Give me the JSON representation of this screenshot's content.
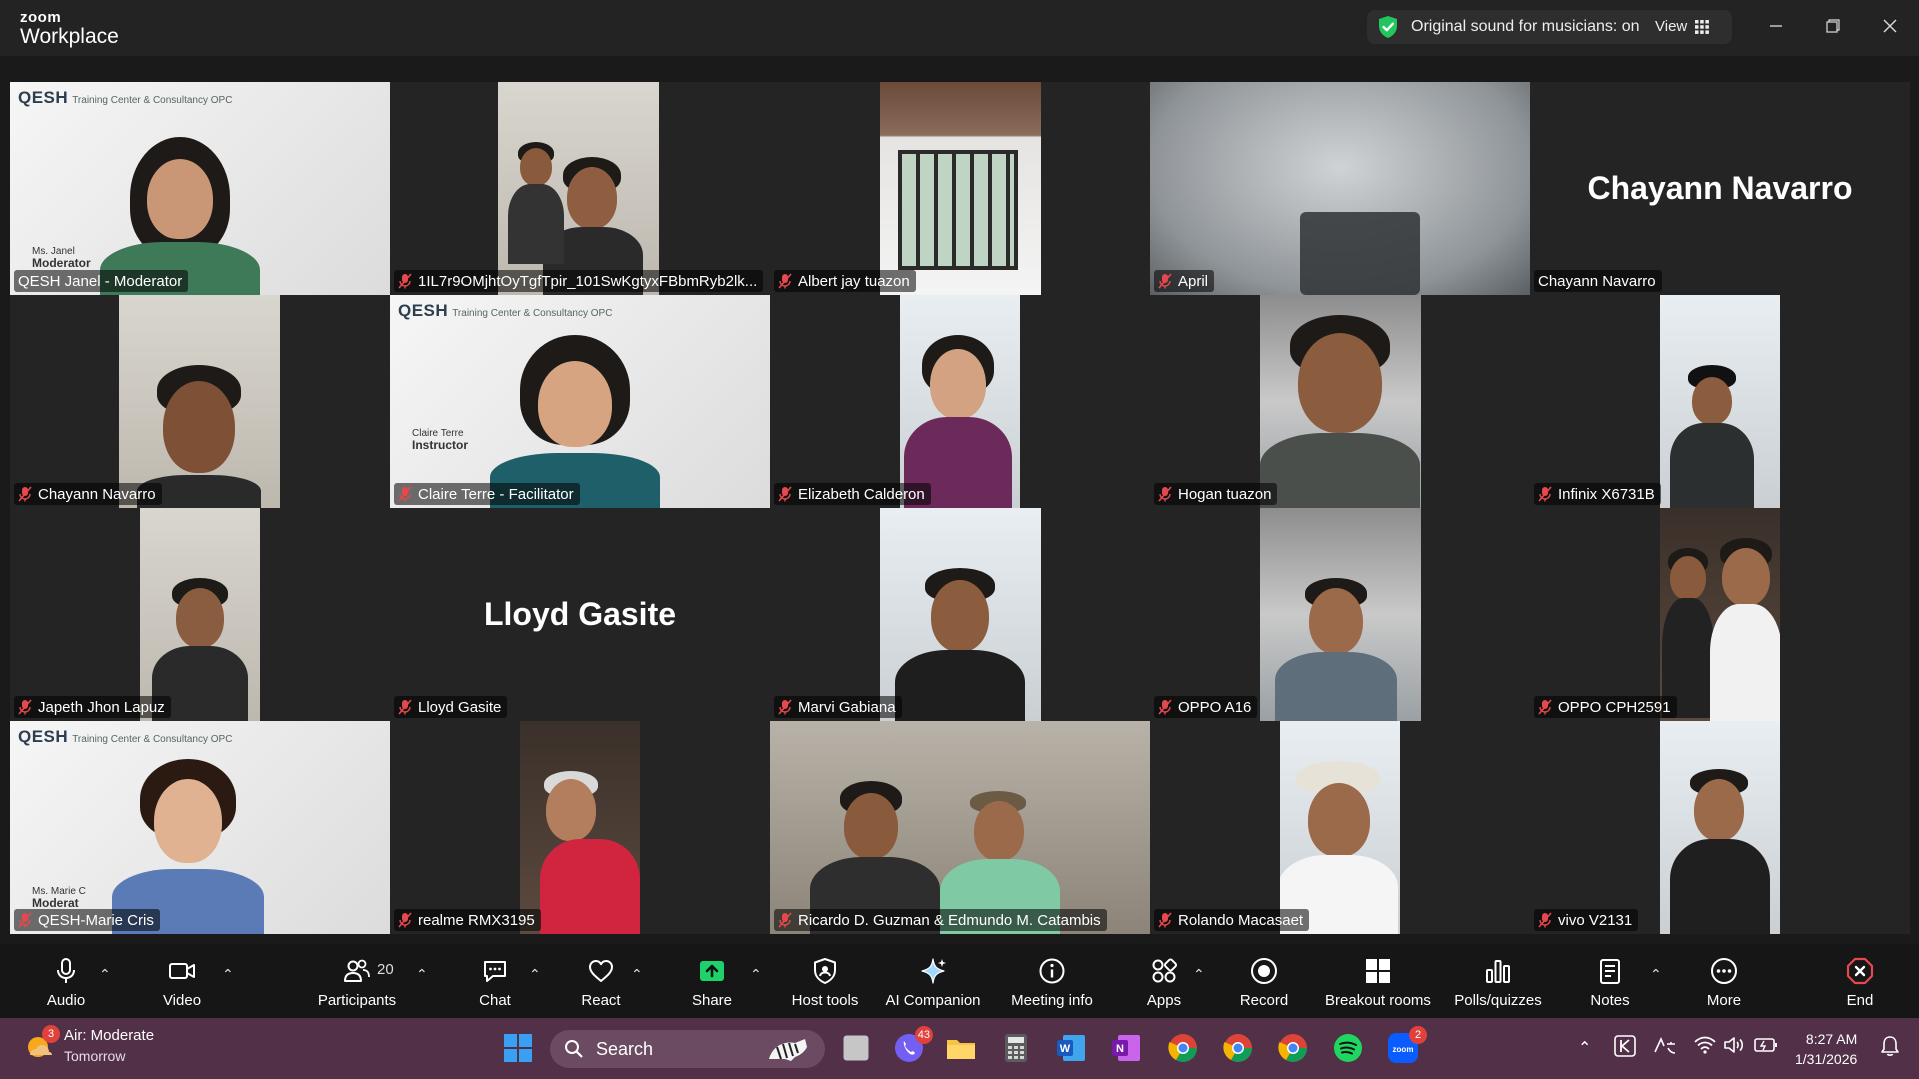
{
  "window": {
    "brand_top": "zoom",
    "brand_bottom": "Workplace",
    "sound_status": "Original sound for musicians: on",
    "view_label": "View"
  },
  "tiles": [
    {
      "name": "QESH Janel - Moderator",
      "muted": false,
      "active": true
    },
    {
      "name": "1IL7r9OMjhtOyTgfTpir_101SwKgtyxFBbmRyb2lk...",
      "muted": true
    },
    {
      "name": "Albert jay tuazon",
      "muted": true
    },
    {
      "name": "April",
      "muted": true
    },
    {
      "name": "Chayann Navarro",
      "muted": false,
      "big_name": "Chayann Navarro"
    },
    {
      "name": "Chayann Navarro",
      "muted": true
    },
    {
      "name": "Claire Terre - Facilitator",
      "muted": true
    },
    {
      "name": "Elizabeth Calderon",
      "muted": true
    },
    {
      "name": "Hogan tuazon",
      "muted": true
    },
    {
      "name": "Infinix X6731B",
      "muted": true
    },
    {
      "name": "Japeth Jhon Lapuz",
      "muted": true
    },
    {
      "name": "Lloyd Gasite",
      "muted": true,
      "big_name": "Lloyd Gasite"
    },
    {
      "name": "Marvi Gabiana",
      "muted": true
    },
    {
      "name": "OPPO A16",
      "muted": true
    },
    {
      "name": "OPPO CPH2591",
      "muted": true
    },
    {
      "name": "QESH-Marie Cris",
      "muted": true
    },
    {
      "name": "realme RMX3195",
      "muted": true
    },
    {
      "name": "Ricardo D. Guzman & Edmundo M. Catambis",
      "muted": true
    },
    {
      "name": "Rolando Macasaet",
      "muted": true
    },
    {
      "name": "vivo V2131",
      "muted": true
    }
  ],
  "video_text": {
    "brand": "QESH",
    "brand_sub": "Training Center & Consultancy OPC",
    "janel_card_1": "Ms. Janel",
    "janel_card_2": "Moderator",
    "claire_card_1": "Claire Terre",
    "claire_card_2": "Instructor",
    "marie_card_1": "Ms. Marie C",
    "marie_card_2": "Moderat"
  },
  "toolbar": {
    "audio": "Audio",
    "video": "Video",
    "participants": "Participants",
    "participants_count": "20",
    "chat": "Chat",
    "react": "React",
    "share": "Share",
    "host_tools": "Host tools",
    "ai_companion": "AI Companion",
    "meeting_info": "Meeting info",
    "apps": "Apps",
    "record": "Record",
    "breakout_rooms": "Breakout rooms",
    "polls": "Polls/quizzes",
    "notes": "Notes",
    "more": "More",
    "end": "End"
  },
  "taskbar": {
    "weather_title": "Air: Moderate",
    "weather_sub": "Tomorrow",
    "weather_badge": "3",
    "search": "Search",
    "viber_badge": "43",
    "zoom_badge": "2",
    "time": "8:27 AM",
    "date": "1/31/2026"
  },
  "colors": {
    "active_speaker": "#2bd26b",
    "share_green": "#1fd16a",
    "end_red": "#e5484d",
    "taskbar": "#523048"
  }
}
